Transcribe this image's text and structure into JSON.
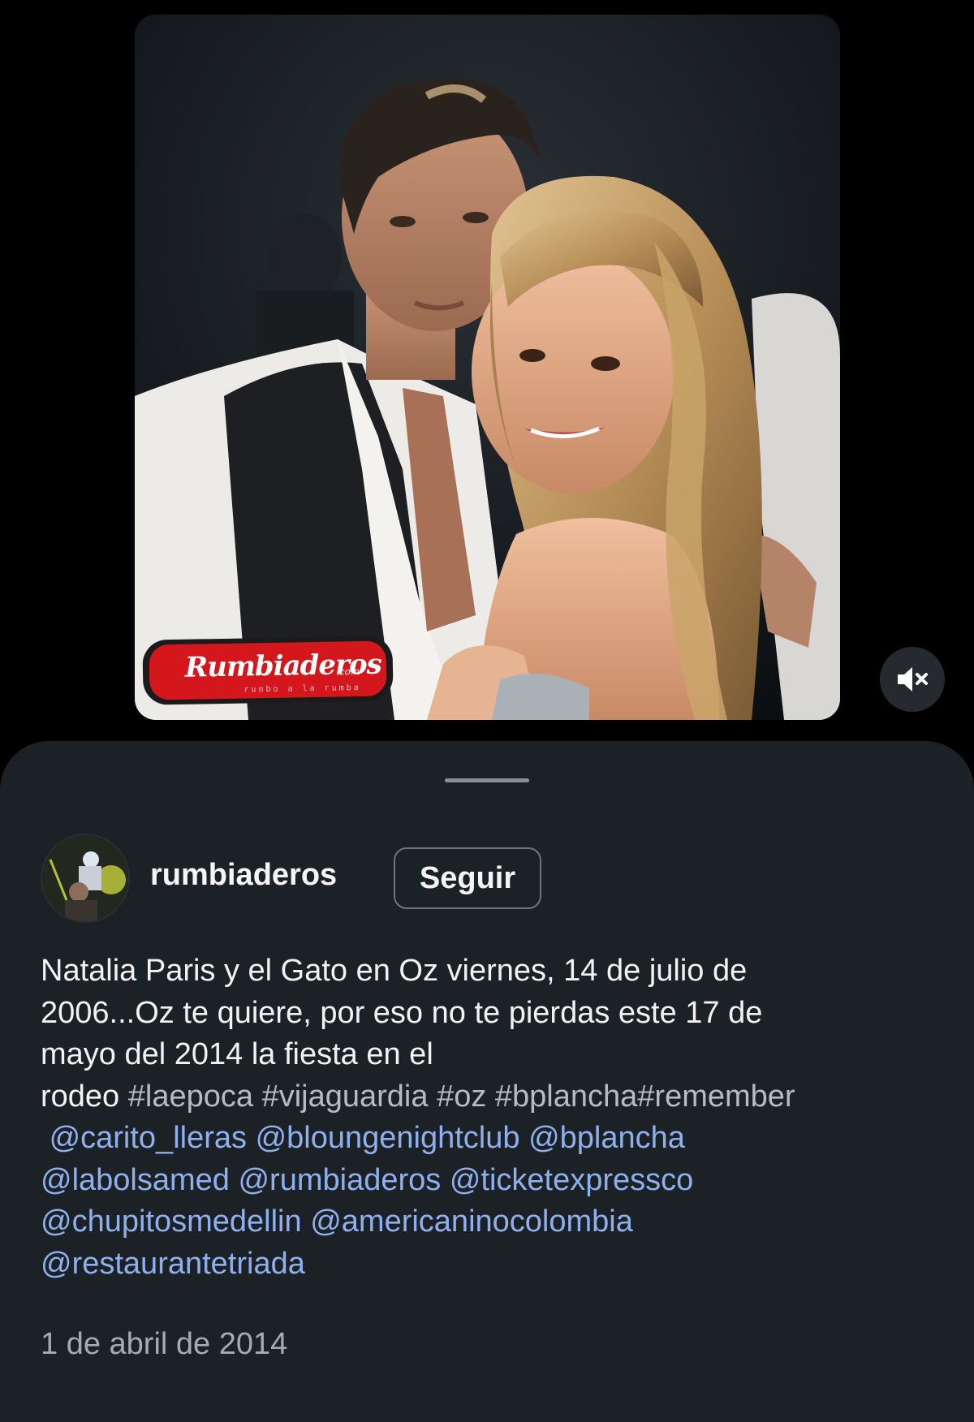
{
  "post": {
    "photo_watermark": {
      "brand": "Rumbiaderos",
      "suffix": ".com",
      "tagline": "rumbo a la rumba"
    },
    "mute_icon": "speaker-muted-icon"
  },
  "sheet": {
    "username": "rumbiaderos",
    "follow_label": "Seguir",
    "caption": {
      "line1": "Natalia Paris y el Gato en Oz viernes, 14 de julio de",
      "line2": "2006...Oz te quiere, por eso no te pierdas este 17 de",
      "line3": "mayo del 2014 la fiesta en el",
      "line4_text": "rodeo",
      "hashtags": [
        "#laepoca",
        "#vijaguardia",
        "#oz",
        "#bplancha#remember"
      ],
      "mentions": [
        "@carito_lleras",
        "@bloungenightclub",
        "@bplancha",
        "@labolsamed",
        "@rumbiaderos",
        "@ticketexpressco",
        "@chupitosmedellin",
        "@americaninocolombia",
        "@restaurantetriada"
      ]
    },
    "date": "1 de abril de 2014"
  },
  "colors": {
    "background": "#000000",
    "sheet": "#1c2126",
    "mention": "#8fb0ee",
    "hashtag": "#b7bcc3",
    "date": "#a6abb2",
    "watermark_red": "#d4171c"
  }
}
